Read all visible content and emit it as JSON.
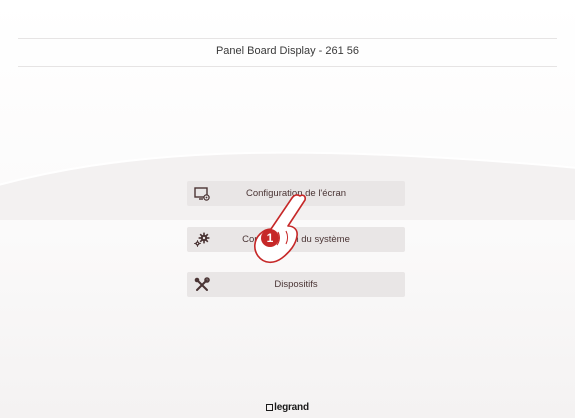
{
  "header": {
    "title": "Panel Board Display - 261 56"
  },
  "menu": {
    "items": [
      {
        "label": "Configuration de l'écran",
        "icon": "screen-settings-icon"
      },
      {
        "label": "Configuration du système",
        "icon": "gears-icon"
      },
      {
        "label": "Dispositifs",
        "icon": "tools-icon"
      }
    ]
  },
  "overlay": {
    "step_number": "1"
  },
  "footer": {
    "brand": "legrand"
  },
  "colors": {
    "button_bg": "#e9e6e6",
    "text": "#4a3434",
    "hand": "#c62828"
  }
}
